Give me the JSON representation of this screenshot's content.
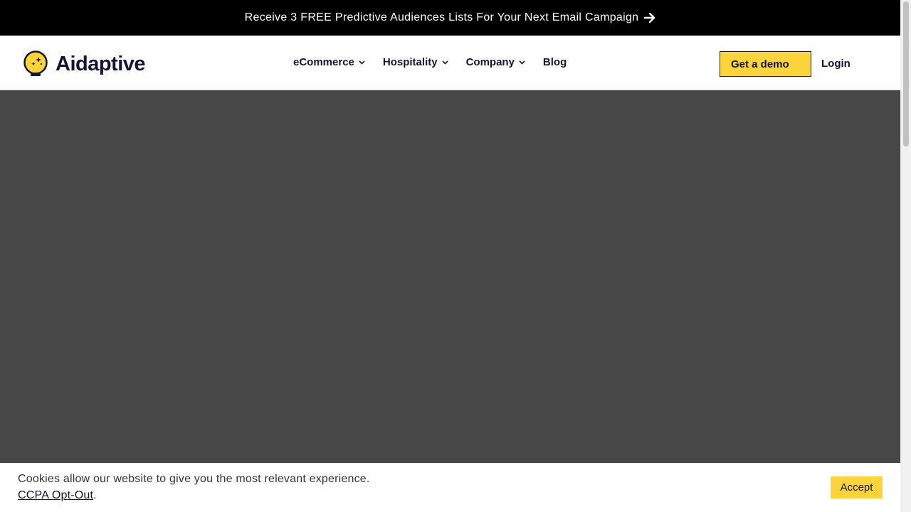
{
  "announcement": {
    "text": "Receive 3 FREE Predictive Audiences Lists For Your Next Email Campaign",
    "icon": "arrow-right-icon"
  },
  "header": {
    "logo_text": "Aidaptive",
    "nav": [
      {
        "label": "eCommerce",
        "has_dropdown": true
      },
      {
        "label": "Hospitality",
        "has_dropdown": true
      },
      {
        "label": "Company",
        "has_dropdown": true
      },
      {
        "label": "Blog",
        "has_dropdown": false
      }
    ],
    "demo_label": "Get a demo",
    "login_label": "Login"
  },
  "cookie": {
    "message": "Cookies allow our website to give you the most relevant experience.",
    "link_label": "CCPA Opt-Out",
    "link_suffix": ".",
    "accept_label": "Accept"
  },
  "colors": {
    "brand_yellow": "#fbd43a",
    "brand_navy": "#141436",
    "hero_bg": "#474747",
    "announce_bg": "#000000"
  }
}
